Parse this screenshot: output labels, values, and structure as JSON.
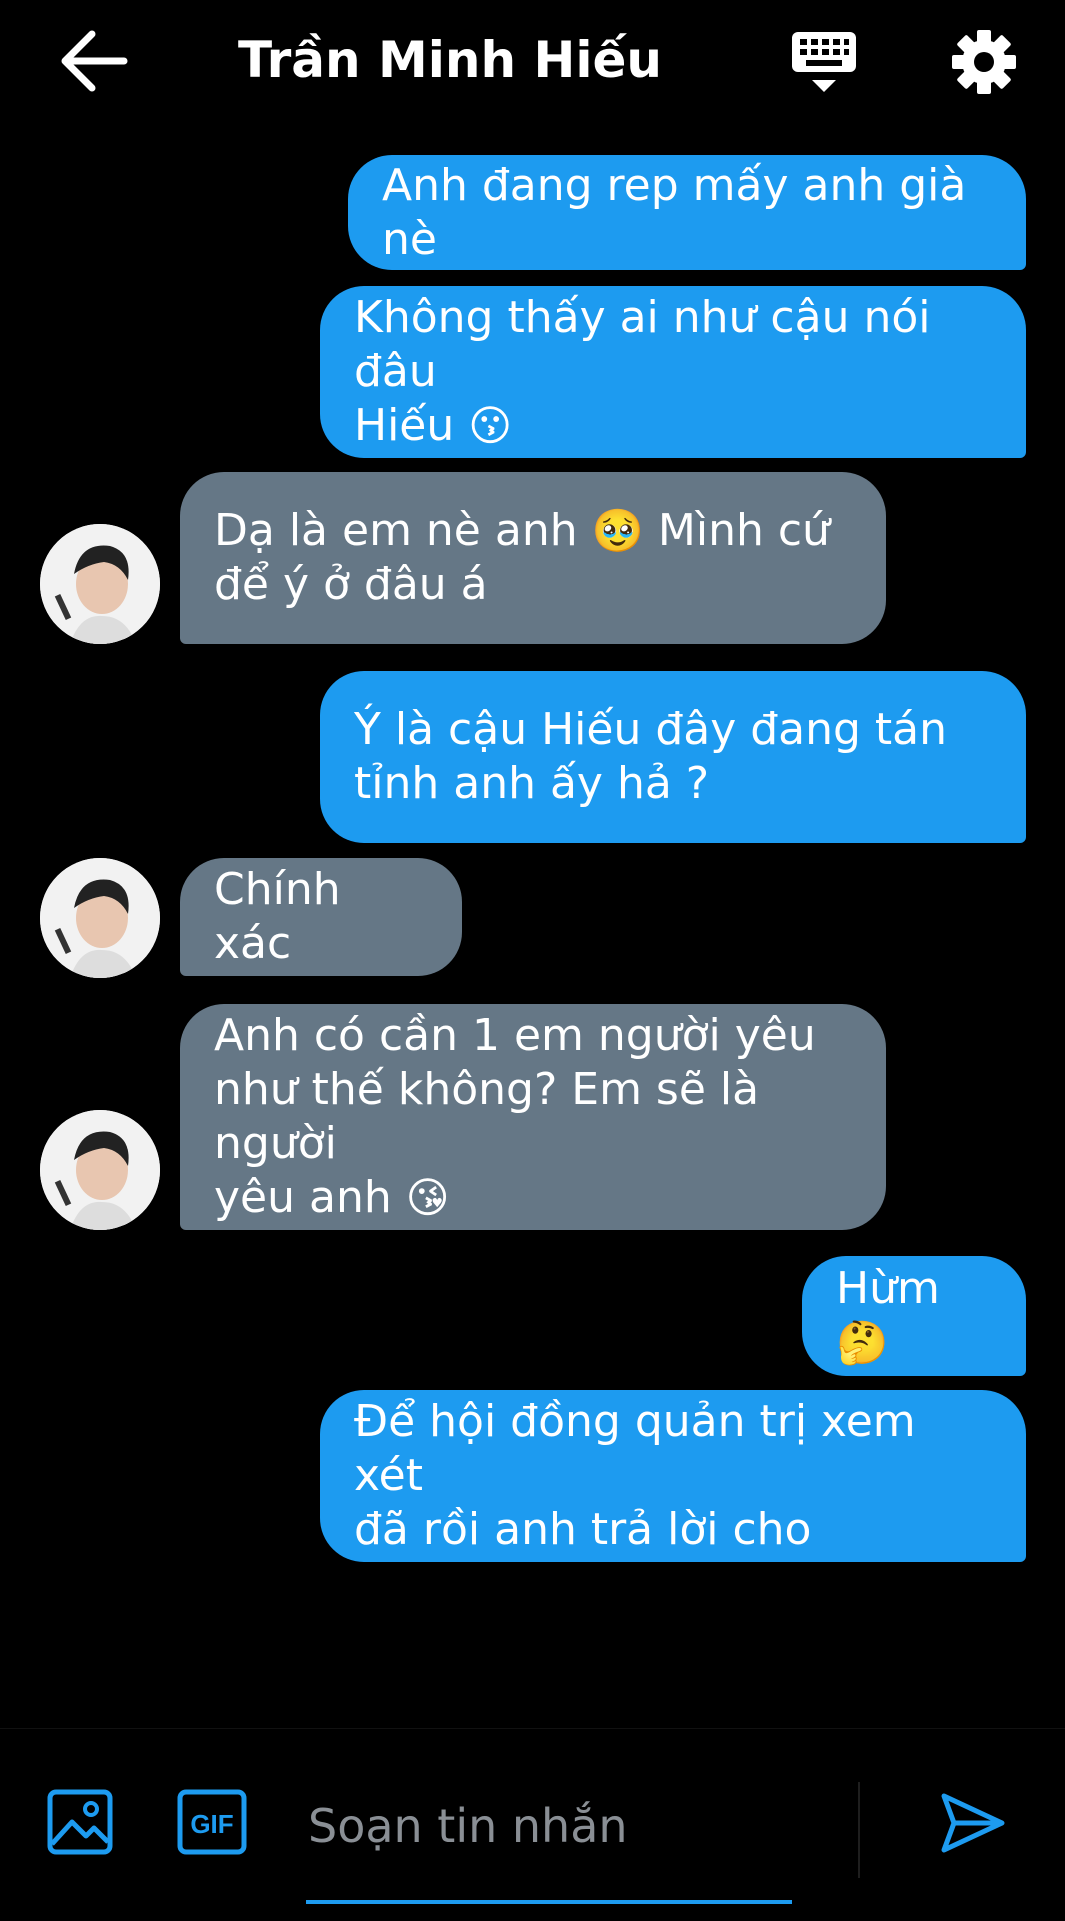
{
  "header": {
    "title": "Trần Minh Hiếu",
    "icons": [
      "arrow-left-icon",
      "keyboard-icon",
      "gear-icon"
    ]
  },
  "messages": [
    {
      "from": "me",
      "text": "Anh đang rep mấy anh già nè"
    },
    {
      "from": "me",
      "text": "Không thấy ai như cậu nói đâu\nHiếu",
      "emoji": "😗"
    },
    {
      "from": "them",
      "text": "Dạ là em nè anh",
      "emoji": "🥹",
      "text2": "Mình cứ\nđể ý ở đâu á"
    },
    {
      "from": "me",
      "text": "Ý là cậu Hiếu đây đang tán\ntỉnh anh ấy hả ?"
    },
    {
      "from": "them",
      "text": "Chính xác"
    },
    {
      "from": "them",
      "text": "Anh có cần 1 em người yêu\nnhư thế không? Em sẽ là người\nyêu anh",
      "emoji": "😘"
    },
    {
      "from": "me",
      "text": "Hừm",
      "emoji": "🤔"
    },
    {
      "from": "me",
      "text": "Để hội đồng quản trị xem xét\nđã rồi anh trả lời cho"
    }
  ],
  "composer": {
    "placeholder": "Soạn tin nhắn",
    "gif_label": "GIF",
    "icons": [
      "image-icon",
      "gif-icon",
      "send-icon"
    ]
  },
  "colors": {
    "background": "#000000",
    "outgoing_bubble": "#1d9bf0",
    "incoming_bubble": "#657786",
    "accent": "#1d9bf0"
  }
}
